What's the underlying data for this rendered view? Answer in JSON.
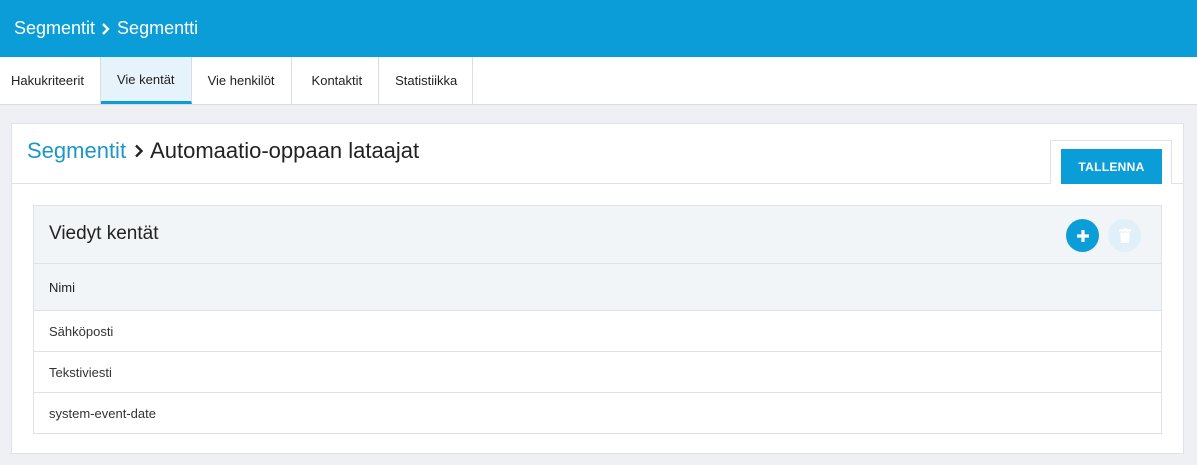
{
  "topbar": {
    "crumb_root": "Segmentit",
    "crumb_current": "Segmentti"
  },
  "tabs": [
    {
      "label": "Hakukriteerit",
      "active": false
    },
    {
      "label": "Vie kentät",
      "active": true
    },
    {
      "label": "Vie henkilöt",
      "active": false
    },
    {
      "label": "Kontaktit",
      "active": false
    },
    {
      "label": "Statistiikka",
      "active": false
    }
  ],
  "card": {
    "crumb_link": "Segmentit",
    "crumb_title": "Automaatio-oppaan lataajat",
    "save_label": "TALLENNA"
  },
  "panel": {
    "title": "Viedyt kentät",
    "add_icon": "plus-icon",
    "delete_icon": "trash-icon",
    "column_header": "Nimi",
    "rows": [
      "Sähköposti",
      "Tekstiviesti",
      "system-event-date"
    ]
  },
  "colors": {
    "accent": "#0b9dd8",
    "link": "#1e96c8",
    "disabled_button": "#e1eff8"
  }
}
